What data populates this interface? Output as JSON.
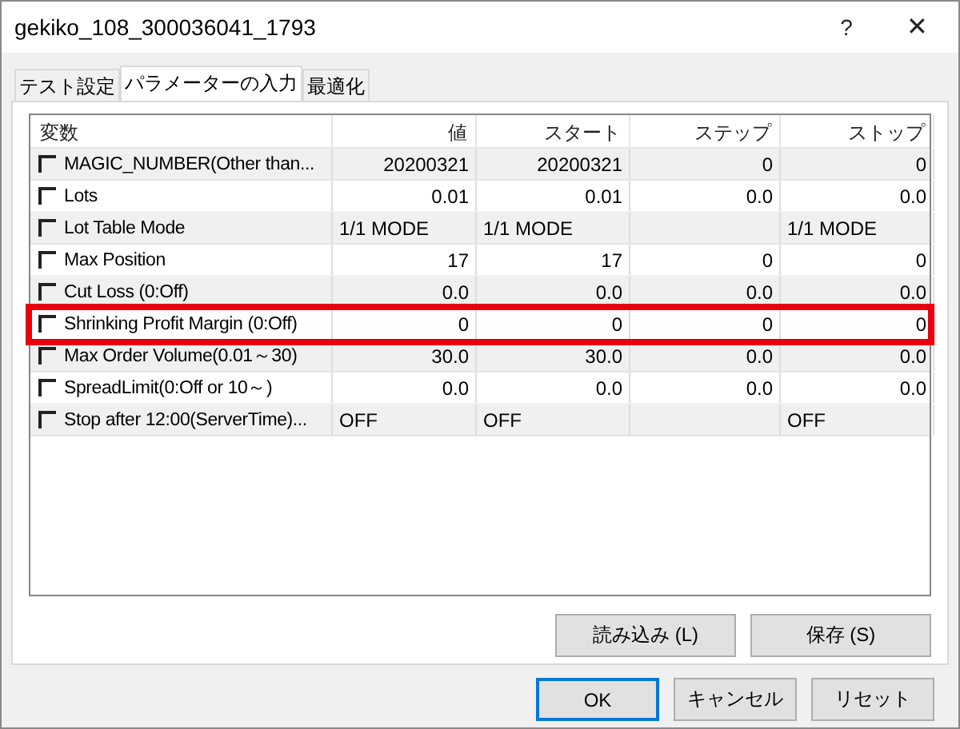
{
  "window": {
    "title": "gekiko_108_300036041_1793",
    "help": "?",
    "close": "✕"
  },
  "tabs": [
    {
      "label": "テスト設定",
      "selected": false
    },
    {
      "label": "パラメーターの入力",
      "selected": true
    },
    {
      "label": "最適化",
      "selected": false
    }
  ],
  "table": {
    "columns": [
      "変数",
      "値",
      "スタート",
      "ステップ",
      "ストップ"
    ],
    "rows": [
      {
        "checked": false,
        "highlighted": false,
        "cells": [
          "MAGIC_NUMBER(Other than...",
          "20200321",
          "20200321",
          "0",
          "0"
        ]
      },
      {
        "checked": false,
        "highlighted": false,
        "cells": [
          "Lots",
          "0.01",
          "0.01",
          "0.0",
          "0.0"
        ]
      },
      {
        "checked": false,
        "highlighted": false,
        "cells": [
          "Lot Table Mode",
          "1/1 MODE",
          "1/1 MODE",
          "",
          "1/1 MODE"
        ],
        "kind": "choice"
      },
      {
        "checked": false,
        "highlighted": false,
        "cells": [
          "Max Position",
          "17",
          "17",
          "0",
          "0"
        ]
      },
      {
        "checked": false,
        "highlighted": false,
        "cells": [
          "Cut Loss (0:Off)",
          "0.0",
          "0.0",
          "0.0",
          "0.0"
        ]
      },
      {
        "checked": false,
        "highlighted": true,
        "cells": [
          "Shrinking Profit Margin (0:Off)",
          "0",
          "0",
          "0",
          "0"
        ]
      },
      {
        "checked": false,
        "highlighted": false,
        "cells": [
          "Max Order Volume(0.01～30)",
          "30.0",
          "30.0",
          "0.0",
          "0.0"
        ]
      },
      {
        "checked": false,
        "highlighted": false,
        "cells": [
          "SpreadLimit(0:Off or 10～)",
          "0.0",
          "0.0",
          "0.0",
          "0.0"
        ]
      },
      {
        "checked": false,
        "highlighted": false,
        "cells": [
          "Stop after 12:00(ServerTime)...",
          "OFF",
          "OFF",
          "",
          "OFF"
        ],
        "kind": "choice"
      }
    ]
  },
  "file_buttons": [
    "読み込み (L)",
    "保存 (S)"
  ],
  "dialog_buttons": [
    {
      "label": "OK",
      "default": true
    },
    {
      "label": "キャンセル",
      "default": false
    },
    {
      "label": "リセット",
      "default": false
    }
  ]
}
